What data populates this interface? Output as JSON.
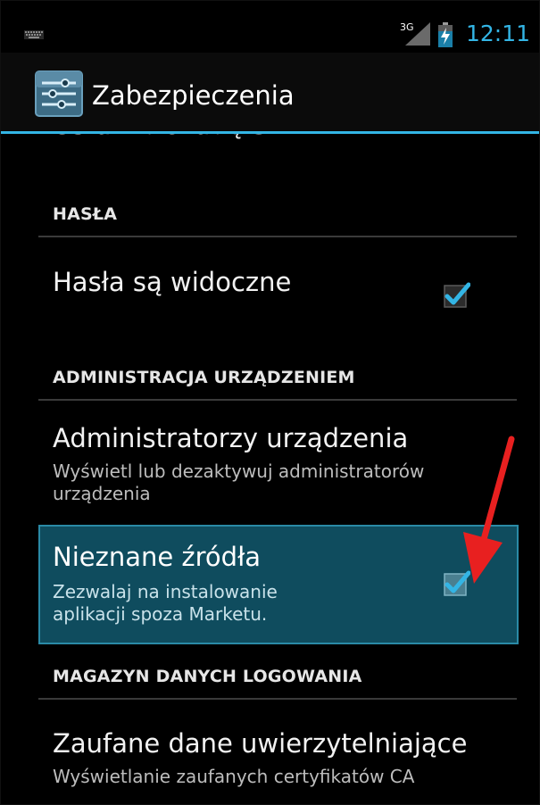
{
  "status_bar": {
    "time": "12:11",
    "network": "3G",
    "icons": [
      "keyboard-icon",
      "signal-icon",
      "battery-charging-icon"
    ]
  },
  "action_bar": {
    "title": "Zabezpieczenia",
    "icon": "settings-sliders-icon"
  },
  "list": {
    "partial_item": "Ustaw blokadę SIM",
    "sections": [
      {
        "header": "HASŁA",
        "items": [
          {
            "title": "Hasła są widoczne",
            "summary": "",
            "checked": true
          }
        ]
      },
      {
        "header": "ADMINISTRACJA URZĄDZENIEM",
        "items": [
          {
            "title": "Administratorzy urządzenia",
            "summary": "Wyświetl lub dezaktywuj administratorów urządzenia"
          },
          {
            "title": "Nieznane źródła",
            "summary": "Zezwalaj na instalowanie aplikacji spoza Marketu.",
            "checked": true,
            "highlighted": true
          }
        ]
      },
      {
        "header": "MAGAZYN DANYCH LOGOWANIA",
        "items": [
          {
            "title": "Zaufane dane uwierzytelniające",
            "summary": "Wyświetlanie zaufanych certyfikatów CA"
          }
        ]
      }
    ]
  },
  "colors": {
    "accent": "#33b5e5",
    "highlight_bg": "#0f4c5e",
    "arrow": "#e82020"
  }
}
